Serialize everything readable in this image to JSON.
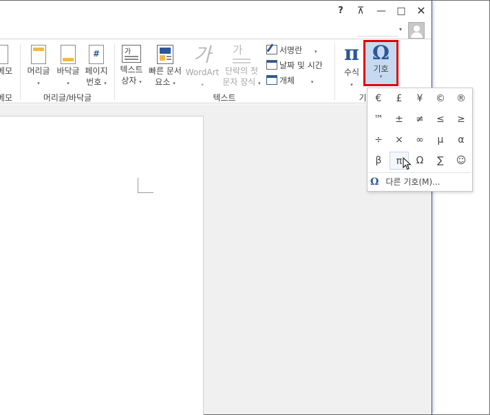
{
  "titlebar": {
    "help": "?",
    "ribbon_options": "⊼",
    "minimize": "—",
    "maximize": "□",
    "close": "✕"
  },
  "ribbon": {
    "groups": {
      "comments_partial": {
        "button_label": "메모",
        "label": "메모"
      },
      "header_footer": {
        "label": "머리글/바닥글",
        "header": "머리글",
        "footer": "바닥글",
        "page_number_line1": "페이지",
        "page_number_line2": "번호"
      },
      "text": {
        "label": "텍스트",
        "textbox_line1": "텍스트",
        "textbox_line2": "상자",
        "quickparts_line1": "빠른 문서",
        "quickparts_line2": "요소",
        "wordart": "WordArt",
        "dropcap_line1": "단락의 첫",
        "dropcap_line2": "문자 장식",
        "signature_line": "서명란",
        "date_time": "날짜 및 시간",
        "object": "개체"
      },
      "symbols": {
        "label_partial": "기",
        "equation": "수식",
        "symbol": "기호"
      }
    }
  },
  "symbol_gallery": {
    "symbols": [
      "€",
      "£",
      "¥",
      "©",
      "®",
      "™",
      "±",
      "≠",
      "≤",
      "≥",
      "÷",
      "×",
      "∞",
      "µ",
      "α",
      "β",
      "π",
      "Ω",
      "∑",
      "☺"
    ],
    "selected_symbol": "π",
    "more_symbols": "다른 기호(M)..."
  },
  "colors": {
    "accent": "#2b579a",
    "highlight_box": "#e00000",
    "selected_button_bg": "#c5daf0"
  }
}
